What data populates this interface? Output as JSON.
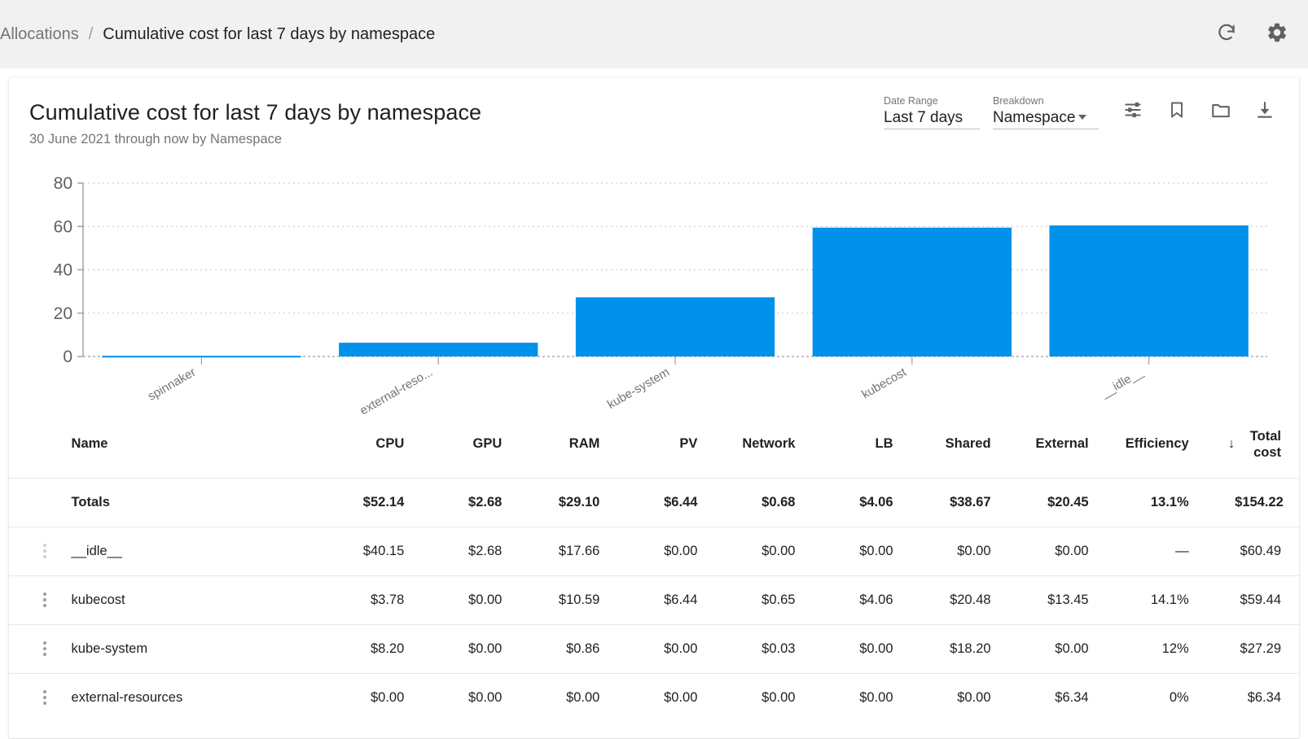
{
  "breadcrumb": {
    "root": "Allocations",
    "separator": "/",
    "current": "Cumulative cost for last 7 days by namespace"
  },
  "topbar": {
    "refresh_icon": "refresh-icon",
    "settings_icon": "gear-icon"
  },
  "card": {
    "title": "Cumulative cost for last 7 days by namespace",
    "subtitle": "30 June 2021 through now by Namespace",
    "controls": {
      "date_range_label": "Date Range",
      "date_range_value": "Last 7 days",
      "breakdown_label": "Breakdown",
      "breakdown_value": "Namespace",
      "icons": [
        "tune-icon",
        "bookmark-icon",
        "folder-icon",
        "download-icon"
      ]
    }
  },
  "colors": {
    "bar": "#0091ea",
    "grid": "#cfcfcf",
    "axis": "#9e9e9e",
    "accent": "#0091ea",
    "header_bg": "#f1f1f1",
    "text": "#212121",
    "muted": "#757575"
  },
  "chart_data": {
    "type": "bar",
    "title": "Cumulative cost for last 7 days by namespace",
    "xlabel": "",
    "ylabel": "",
    "ylim": [
      0,
      80
    ],
    "yticks": [
      0,
      20,
      40,
      60,
      80
    ],
    "grid": true,
    "legend": "none",
    "categories": [
      "spinnaker",
      "external-reso...",
      "kube-system",
      "kubecost",
      "__idle__"
    ],
    "category_full": [
      "spinnaker",
      "external-resources",
      "kube-system",
      "kubecost",
      "__idle__"
    ],
    "values": [
      0.3,
      6.34,
      27.29,
      59.44,
      60.49
    ],
    "series": [
      {
        "name": "Total cost",
        "values": [
          0.3,
          6.34,
          27.29,
          59.44,
          60.49
        ]
      }
    ]
  },
  "table": {
    "headers": [
      "Name",
      "CPU",
      "GPU",
      "RAM",
      "PV",
      "Network",
      "LB",
      "Shared",
      "External",
      "Efficiency"
    ],
    "sort_indicator": "↓",
    "total_header_line1": "Total",
    "total_header_line2": "cost",
    "totals_row": {
      "name": "Totals",
      "cpu": "$52.14",
      "gpu": "$2.68",
      "ram": "$29.10",
      "pv": "$6.44",
      "network": "$0.68",
      "lb": "$4.06",
      "shared": "$38.67",
      "external": "$20.45",
      "efficiency": "13.1%",
      "total": "$154.22"
    },
    "rows": [
      {
        "name": "__idle__",
        "cpu": "$40.15",
        "gpu": "$2.68",
        "ram": "$17.66",
        "pv": "$0.00",
        "network": "$0.00",
        "lb": "$0.00",
        "shared": "$0.00",
        "external": "$0.00",
        "efficiency": "—",
        "total": "$60.49"
      },
      {
        "name": "kubecost",
        "cpu": "$3.78",
        "gpu": "$0.00",
        "ram": "$10.59",
        "pv": "$6.44",
        "network": "$0.65",
        "lb": "$4.06",
        "shared": "$20.48",
        "external": "$13.45",
        "efficiency": "14.1%",
        "total": "$59.44"
      },
      {
        "name": "kube-system",
        "cpu": "$8.20",
        "gpu": "$0.00",
        "ram": "$0.86",
        "pv": "$0.00",
        "network": "$0.03",
        "lb": "$0.00",
        "shared": "$18.20",
        "external": "$0.00",
        "efficiency": "12%",
        "total": "$27.29"
      },
      {
        "name": "external-resources",
        "cpu": "$0.00",
        "gpu": "$0.00",
        "ram": "$0.00",
        "pv": "$0.00",
        "network": "$0.00",
        "lb": "$0.00",
        "shared": "$0.00",
        "external": "$6.34",
        "efficiency": "0%",
        "total": "$6.34"
      }
    ]
  }
}
